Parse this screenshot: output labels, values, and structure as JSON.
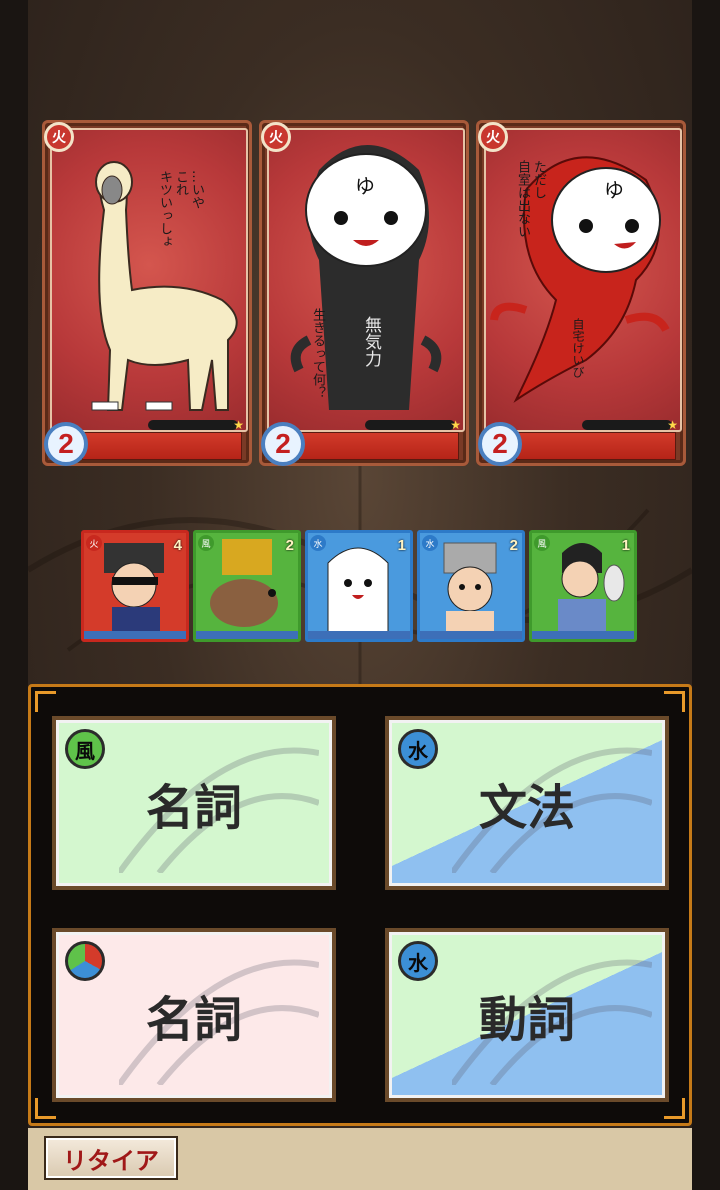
{
  "enemies": [
    {
      "element": "火",
      "cost": "2",
      "speech": [
        "…いや",
        "これ",
        "キツいっしょ"
      ]
    },
    {
      "element": "火",
      "cost": "2",
      "speech": [
        "生きるって何？"
      ],
      "shirt_text": "無気力",
      "face_text": "ゆ"
    },
    {
      "element": "火",
      "cost": "2",
      "speech": [
        "ただし",
        "自室は出ない"
      ],
      "shirt_text": "自宅けいび",
      "face_text": "ゆ"
    }
  ],
  "party": [
    {
      "element": "火",
      "number": "4",
      "frame_color": "#c8281e"
    },
    {
      "element": "風",
      "number": "2",
      "frame_color": "#3f9a2c"
    },
    {
      "element": "水",
      "number": "1",
      "frame_color": "#2d7ac8"
    },
    {
      "element": "水",
      "number": "2",
      "frame_color": "#2d7ac8"
    },
    {
      "element": "風",
      "number": "1",
      "frame_color": "#3f9a2c"
    }
  ],
  "choices": [
    {
      "label": "名詞",
      "element": "風",
      "style": "green"
    },
    {
      "label": "文法",
      "element": "水",
      "style": "green-blue"
    },
    {
      "label": "名詞",
      "element": "",
      "style": "pink"
    },
    {
      "label": "動詞",
      "element": "水",
      "style": "green-blue"
    }
  ],
  "retire_label": "リタイア",
  "colors": {
    "panel_border": "#c67a18",
    "card_red": "#b8393a",
    "hp_bar": "#d23a2a",
    "choice_green": "#d4f7cf",
    "choice_blue": "#8fc0f0",
    "choice_pink": "#fde9e9"
  }
}
